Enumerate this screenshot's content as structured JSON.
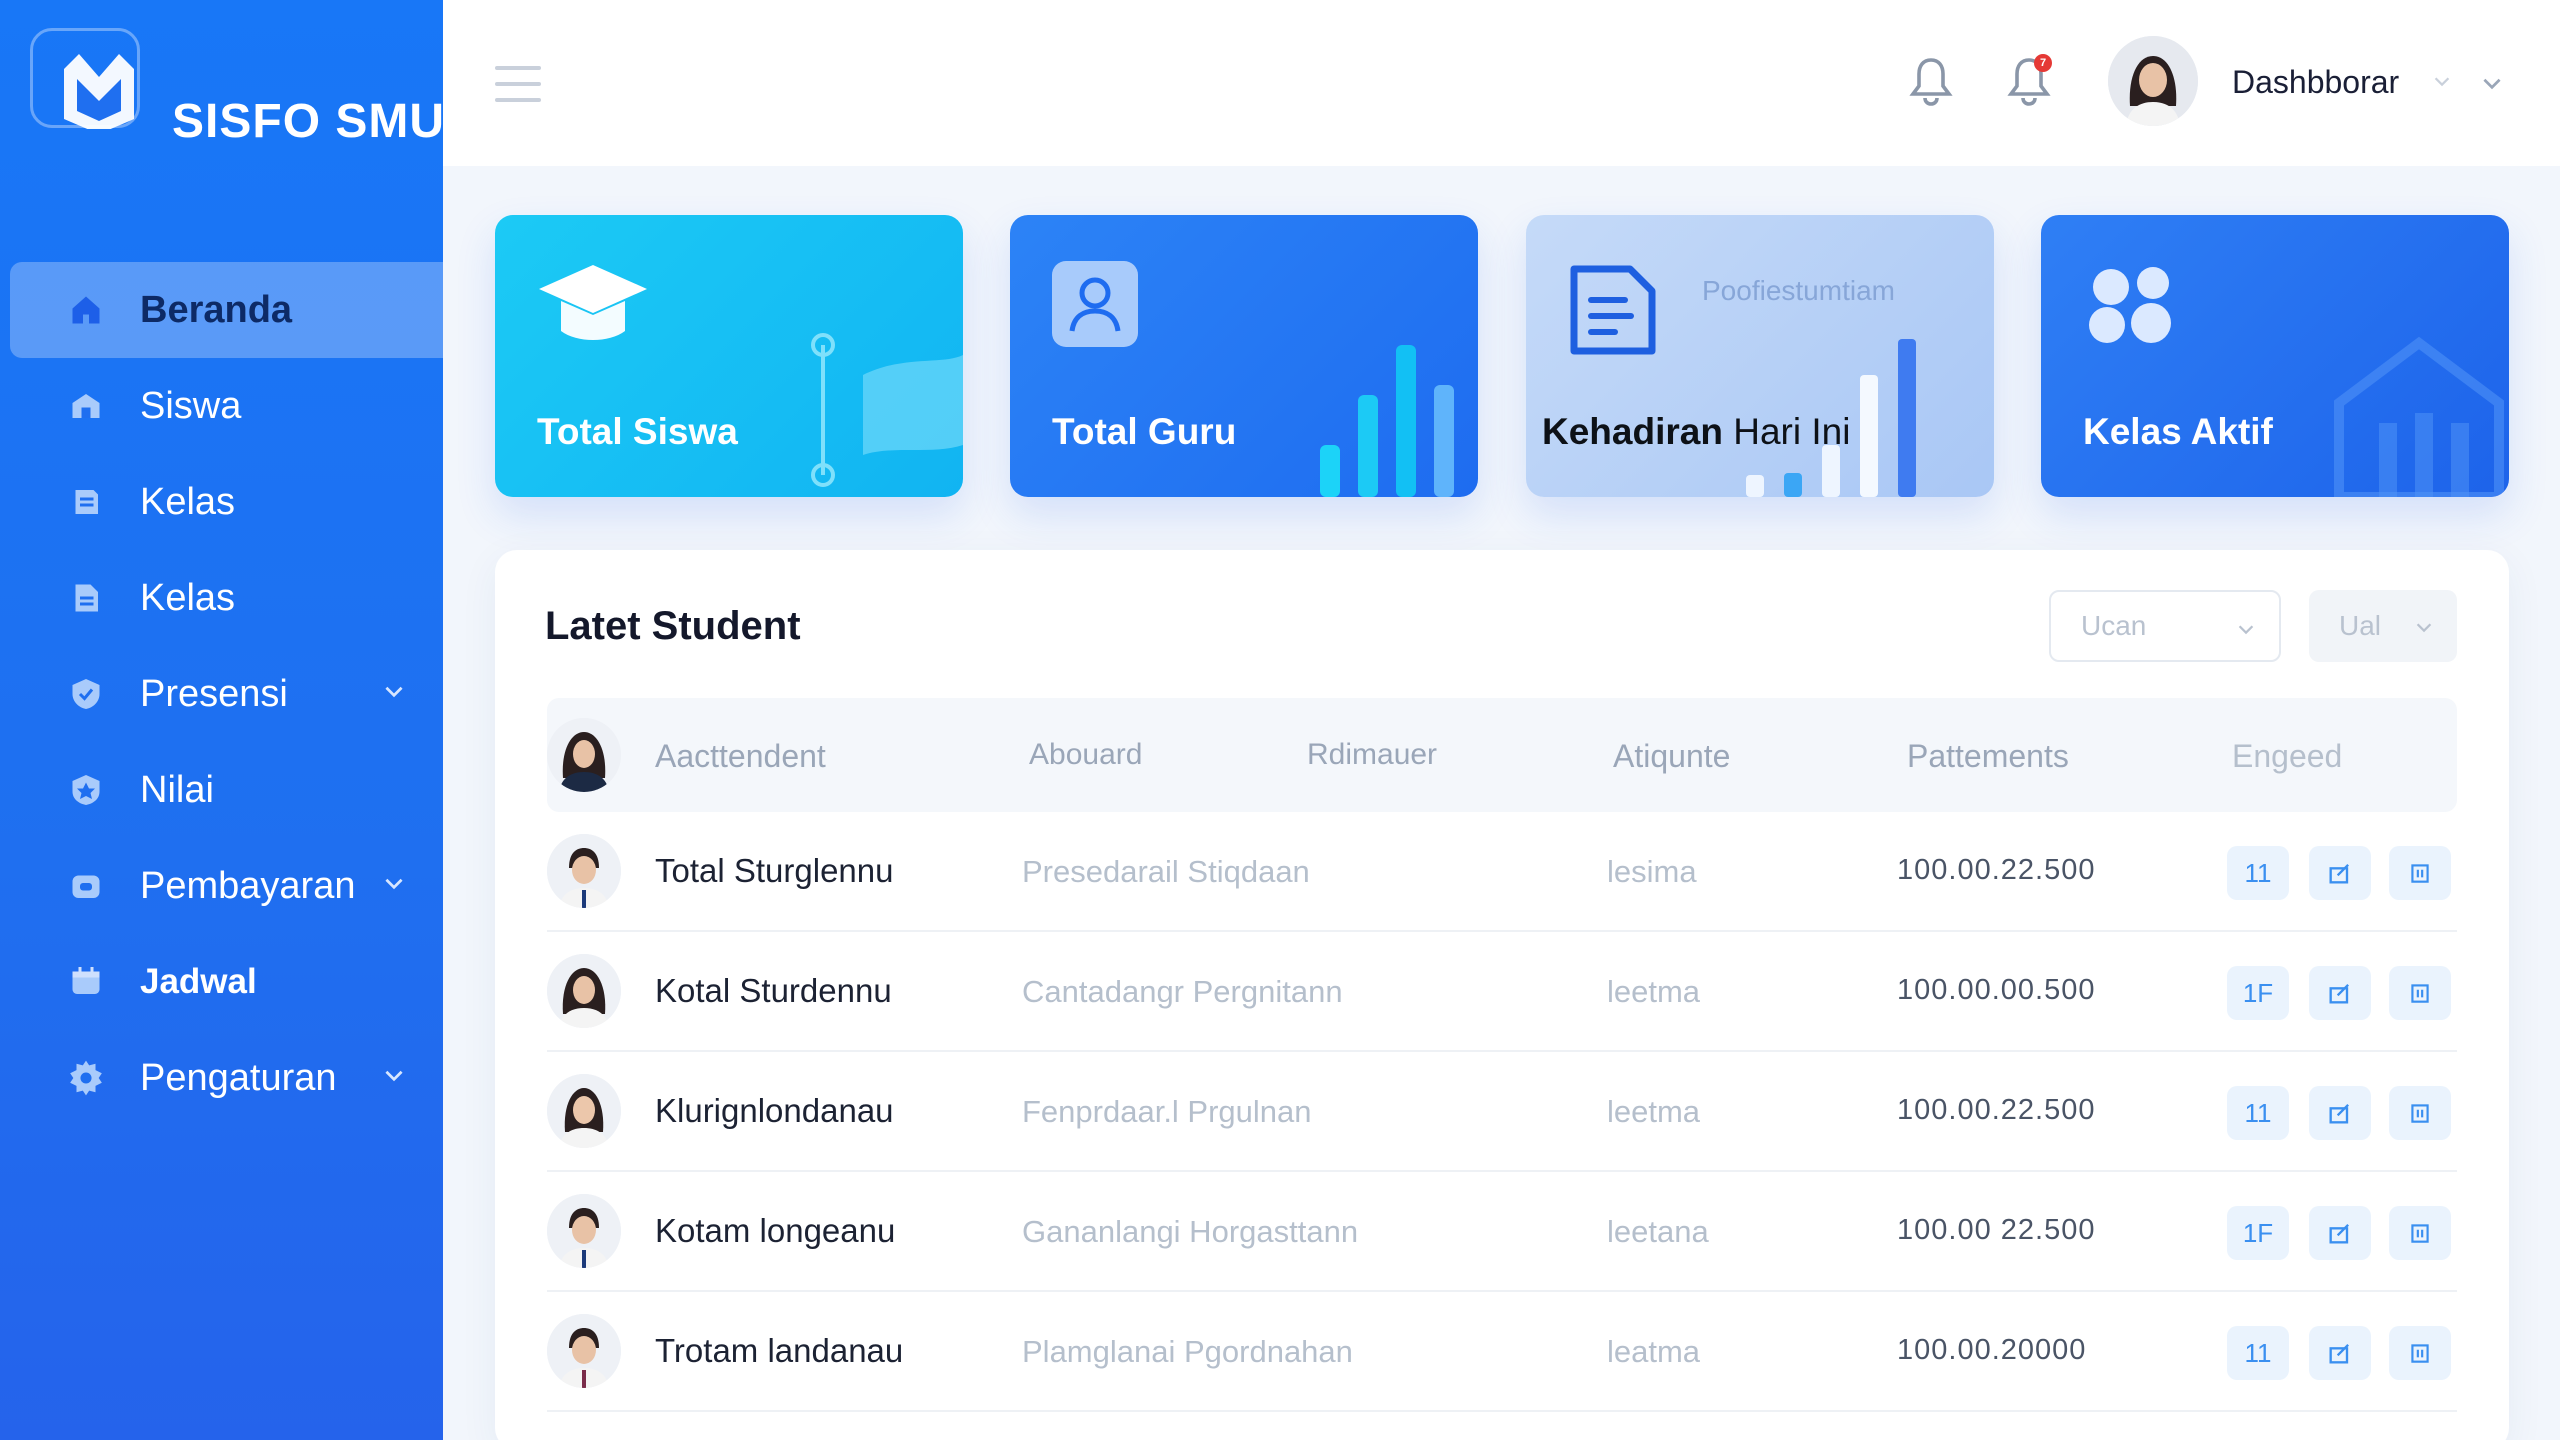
{
  "brand": {
    "name": "SISFO SMU"
  },
  "sidebar": {
    "items": [
      {
        "label": "Beranda",
        "icon": "home-icon",
        "active": true
      },
      {
        "label": "Siswa",
        "icon": "school-icon"
      },
      {
        "label": "Kelas",
        "icon": "book-icon"
      },
      {
        "label": "Kelas",
        "icon": "document-icon"
      },
      {
        "label": "Presensi",
        "icon": "shield-check-icon",
        "expandable": true
      },
      {
        "label": "Nilai",
        "icon": "badge-icon"
      },
      {
        "label": "Pembayaran",
        "icon": "wallet-icon",
        "expandable": true
      },
      {
        "label": "Jadwal",
        "icon": "calendar-icon"
      },
      {
        "label": "Pengaturan",
        "icon": "gear-icon",
        "expandable": true
      }
    ]
  },
  "topbar": {
    "user_name": "Dashbborar",
    "notification_count": "7"
  },
  "cards": [
    {
      "title": "Total Siswa",
      "icon": "graduation-cap-icon"
    },
    {
      "title": "Total Guru",
      "icon": "user-icon"
    },
    {
      "title_bold": "Kehadiran",
      "title_light": " Hari Ini",
      "subtitle": "Poofiestumtiam",
      "icon": "clipboard-icon"
    },
    {
      "title": "Kelas Aktif",
      "icon": "group-icon"
    }
  ],
  "table": {
    "title": "Latet Student",
    "filters": [
      "Ucan",
      "Ual"
    ],
    "headers": [
      "Aacttendent",
      "Abouard",
      "Rdimauer",
      "Atiqunte",
      "Pattements",
      "Engeed"
    ],
    "rows": [
      {
        "name": "Total Sturglennu",
        "detail": "Presedarail Stiqdaan",
        "status": "lesima",
        "payment": "100.00.22.500",
        "actions": [
          "11",
          "edit-icon",
          "delete-icon"
        ]
      },
      {
        "name": "Kotal Sturdennu",
        "detail": "Cantadangr Pergnitann",
        "status": "leetma",
        "payment": "100.00.00.500",
        "actions": [
          "1F",
          "edit-icon",
          "delete-icon"
        ]
      },
      {
        "name": "Klurignlondanau",
        "detail": "Fenprdaar.l Prgulnan",
        "status": "leetma",
        "payment": "100.00.22.500",
        "actions": [
          "11",
          "edit-icon",
          "delete-icon"
        ]
      },
      {
        "name": "Kotam longeanu",
        "detail": "Gananlangi Horgasttann",
        "status": "leetana",
        "payment": "100.00 22.500",
        "actions": [
          "1F",
          "edit-icon",
          "delete-icon"
        ]
      },
      {
        "name": "Trotam landanau",
        "detail": "Plamglanai Pgordnahan",
        "status": "leatma",
        "payment": "100.00.20000",
        "actions": [
          "11",
          "edit-icon",
          "delete-icon"
        ]
      }
    ]
  },
  "colors": {
    "sidebar": "#1f6ff0",
    "accent": "#2563eb",
    "card_cyan": "#11b4f2",
    "badge": "#e53935"
  }
}
